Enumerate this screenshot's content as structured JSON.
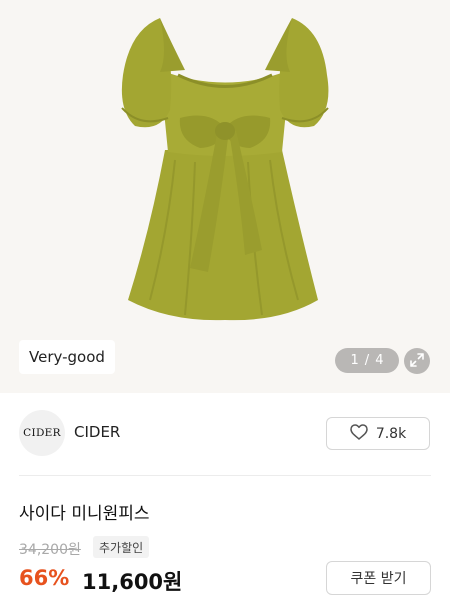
{
  "gallery": {
    "condition_badge": "Very-good",
    "current_index": "1",
    "separator": "/",
    "total": "4"
  },
  "brand": {
    "logo_text": "CIDER",
    "name": "CIDER"
  },
  "likes": {
    "count": "7.8k"
  },
  "product": {
    "title": "사이다 미니원피스",
    "original_price": "34,200원",
    "extra_discount_label": "추가할인",
    "discount_rate": "66%",
    "sale_price": "11,600원"
  },
  "coupon": {
    "label": "쿠폰 받기"
  },
  "colors": {
    "discount": "#e7521e",
    "dress": "#a3a632",
    "hero_background": "#f8f6f3"
  },
  "icons": {
    "expand": "expand-arrows-icon",
    "like": "heart-outline-icon"
  }
}
